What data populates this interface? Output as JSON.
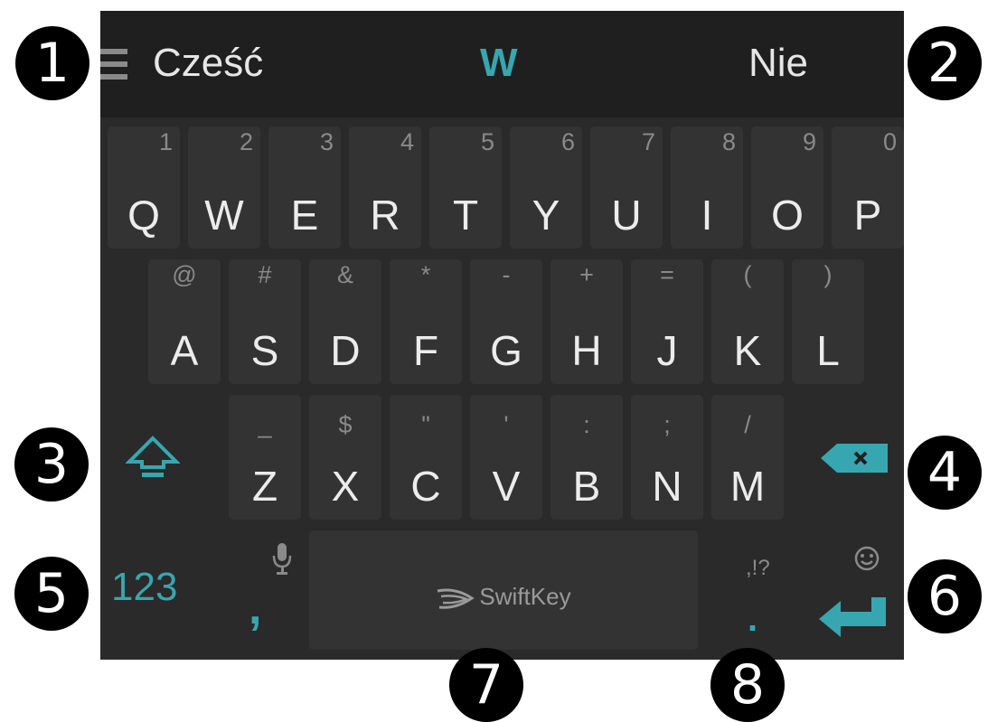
{
  "suggestions": {
    "left": "Cześć",
    "middle": "W",
    "right": "Nie"
  },
  "rows": {
    "row1": [
      {
        "main": "Q",
        "hint": "1"
      },
      {
        "main": "W",
        "hint": "2"
      },
      {
        "main": "E",
        "hint": "3"
      },
      {
        "main": "R",
        "hint": "4"
      },
      {
        "main": "T",
        "hint": "5"
      },
      {
        "main": "Y",
        "hint": "6"
      },
      {
        "main": "U",
        "hint": "7"
      },
      {
        "main": "I",
        "hint": "8"
      },
      {
        "main": "O",
        "hint": "9"
      },
      {
        "main": "P",
        "hint": "0"
      }
    ],
    "row2": [
      {
        "main": "A",
        "hint": "@"
      },
      {
        "main": "S",
        "hint": "#"
      },
      {
        "main": "D",
        "hint": "&"
      },
      {
        "main": "F",
        "hint": "*"
      },
      {
        "main": "G",
        "hint": "-"
      },
      {
        "main": "H",
        "hint": "+"
      },
      {
        "main": "J",
        "hint": "="
      },
      {
        "main": "K",
        "hint": "("
      },
      {
        "main": "L",
        "hint": ")"
      }
    ],
    "row3": [
      {
        "main": "Z",
        "hint": "_"
      },
      {
        "main": "X",
        "hint": "$"
      },
      {
        "main": "C",
        "hint": "\""
      },
      {
        "main": "V",
        "hint": "'"
      },
      {
        "main": "B",
        "hint": ":"
      },
      {
        "main": "N",
        "hint": ";"
      },
      {
        "main": "M",
        "hint": "/"
      }
    ]
  },
  "bottom": {
    "numbers_label": "123",
    "comma_label": ",",
    "brand_label": "SwiftKey",
    "punct_hint": ",!?",
    "period_label": "."
  },
  "icons": {
    "menu": "menu-icon",
    "shift": "shift-icon",
    "backspace": "backspace-icon",
    "mic": "microphone-icon",
    "emoji": "emoji-icon",
    "enter": "enter-icon",
    "swiftkey": "swiftkey-logo-icon"
  },
  "colors": {
    "accent": "#36a7b0",
    "keyboard_bg": "#2a2a2a",
    "key_bg": "#333333",
    "suggestion_bar": "#1f1f1f"
  },
  "callouts": [
    "1",
    "2",
    "3",
    "4",
    "5",
    "6",
    "7",
    "8"
  ]
}
